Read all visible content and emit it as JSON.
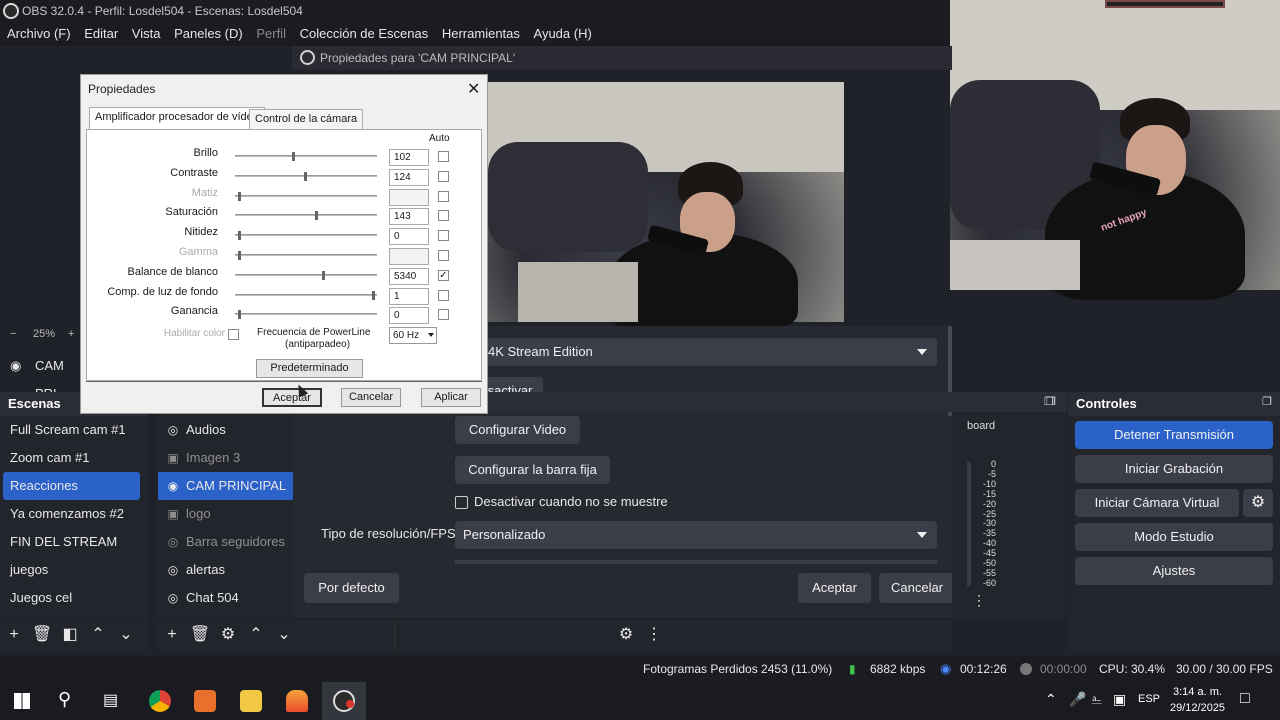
{
  "window": {
    "title": "OBS 32.0.4 - Perfil: Losdel504 - Escenas: Losdel504"
  },
  "menu": [
    "Archivo (F)",
    "Editar",
    "Vista",
    "Paneles (D)",
    "Perfil",
    "Colección de Escenas",
    "Herramientas",
    "Ayuda (H)"
  ],
  "props_window_header": "Propiedades para 'CAM PRINCIPAL'",
  "preview": {
    "zoom": "25%",
    "source_label": "CAM PRI"
  },
  "dialog": {
    "title": "Propiedades",
    "tabs": [
      "Amplificador procesador de vídeo",
      "Control de la cámara"
    ],
    "auto_label": "Auto",
    "rows": [
      {
        "label": "Brillo",
        "value": "102",
        "level": 0.41,
        "enabled": true,
        "auto": false
      },
      {
        "label": "Contraste",
        "value": "124",
        "level": 0.49,
        "enabled": true,
        "auto": false
      },
      {
        "label": "Matiz",
        "value": "",
        "level": 0.02,
        "enabled": false,
        "auto": false
      },
      {
        "label": "Saturación",
        "value": "143",
        "level": 0.57,
        "enabled": true,
        "auto": false
      },
      {
        "label": "Nitidez",
        "value": "0",
        "level": 0.02,
        "enabled": true,
        "auto": false
      },
      {
        "label": "Gamma",
        "value": "",
        "level": 0.02,
        "enabled": false,
        "auto": false
      },
      {
        "label": "Balance de blanco",
        "value": "5340",
        "level": 0.62,
        "enabled": true,
        "auto": true
      },
      {
        "label": "Comp. de luz de fondo",
        "value": "1",
        "level": 0.98,
        "enabled": true,
        "auto": false
      },
      {
        "label": "Ganancia",
        "value": "0",
        "level": 0.02,
        "enabled": true,
        "auto": false
      }
    ],
    "habilitar_color": "Habilitar color",
    "powerline_label": "Frecuencia de PowerLine",
    "powerline_sub": "(antiparpadeo)",
    "powerline_value": "60 Hz",
    "default_button": "Predeterminado",
    "ok": "Aceptar",
    "cancel": "Cancelar",
    "apply": "Aplicar"
  },
  "behind": {
    "edition_select": "4K Stream Edition",
    "deactivate_btn": "sactivar",
    "configure_video": "Configurar Video",
    "configure_bar": "Configurar la barra fija",
    "deactivate_hidden": "Desactivar cuando no se muestre",
    "resolution_label": "Tipo de resolución/FPS",
    "resolution_value": "Personalizado",
    "defaults_btn": "Por defecto",
    "accept_btn": "Aceptar",
    "cancel_btn": "Cancelar",
    "mixer_partial": "board",
    "meter_ticks": [
      "0",
      "-5",
      "-10",
      "-15",
      "-20",
      "-25",
      "-30",
      "-35",
      "-40",
      "-45",
      "-50",
      "-55",
      "-60"
    ]
  },
  "scenes": {
    "title": "Escenas",
    "items": [
      "Full Scream cam #1",
      "Zoom cam #1",
      "Reacciones",
      "Ya comenzamos #2",
      "FIN DEL STREAM",
      "juegos",
      "Juegos cel"
    ],
    "selected_index": 2
  },
  "sources": {
    "items": [
      {
        "label": "Audios",
        "icon": "globe-icon",
        "dim": false
      },
      {
        "label": "Imagen 3",
        "icon": "image-icon",
        "dim": true
      },
      {
        "label": "CAM PRINCIPAL",
        "icon": "camera-icon",
        "dim": false,
        "selected": true
      },
      {
        "label": "logo",
        "icon": "image-icon",
        "dim": true
      },
      {
        "label": "Barra seguidores",
        "icon": "globe-icon",
        "dim": true
      },
      {
        "label": "alertas",
        "icon": "globe-icon",
        "dim": false
      },
      {
        "label": "Chat 504",
        "icon": "globe-icon",
        "dim": false
      }
    ]
  },
  "controls": {
    "title": "Controles",
    "stop_stream": "Detener Transmisión",
    "start_rec": "Iniciar Grabación",
    "virtual_cam": "Iniciar Cámara Virtual",
    "studio_mode": "Modo Estudio",
    "settings": "Ajustes"
  },
  "status": {
    "dropped": "Fotogramas Perdidos 2453 (11.0%)",
    "bitrate": "6882 kbps",
    "stream_time": "00:12:26",
    "rec_time": "00:00:00",
    "cpu": "CPU: 30.4%",
    "fps": "30.00 / 30.00 FPS"
  },
  "taskbar": {
    "lang": "ESP",
    "time": "3:14 a. m.",
    "date": "29/12/2025"
  },
  "shirt_text": "not happy"
}
